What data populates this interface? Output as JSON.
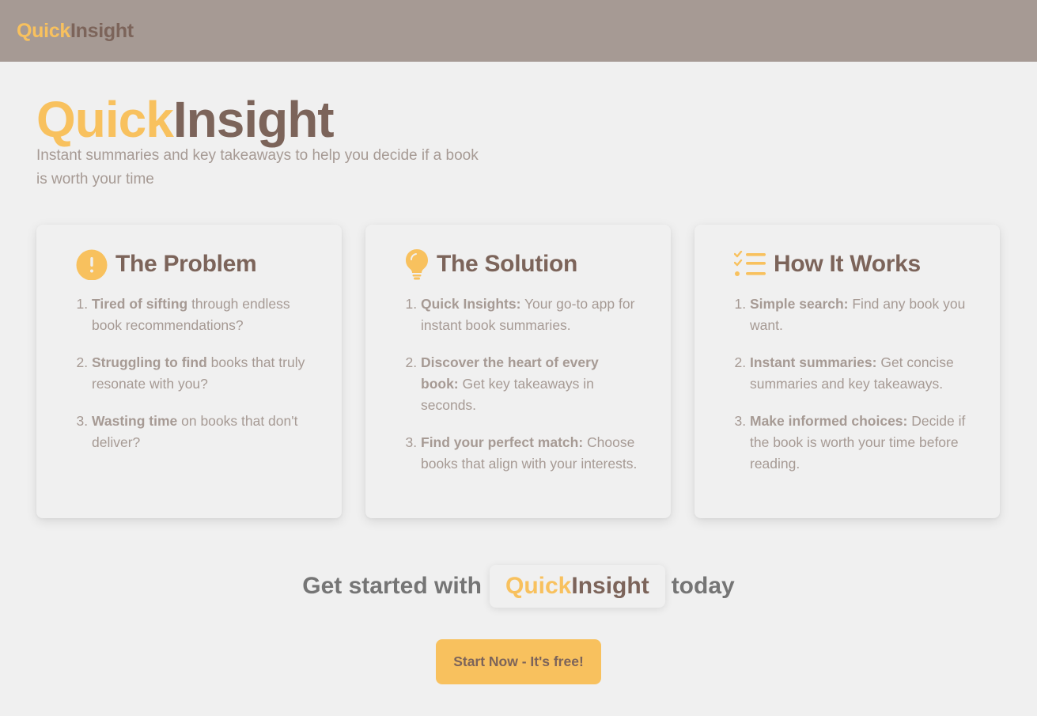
{
  "topbar": {
    "logo_part1": "Quick",
    "logo_part2": "Insight"
  },
  "hero": {
    "title_part1": "Quick",
    "title_part2": "Insight",
    "subtitle": "Instant summaries and key takeaways to help you decide if a book is worth your time"
  },
  "cards": [
    {
      "icon": "exclamation-circle-icon",
      "title": "The Problem",
      "items": [
        {
          "bold": "Tired of sifting",
          "text": " through endless book recommendations?"
        },
        {
          "bold": "Struggling to find",
          "text": " books that truly resonate with you?"
        },
        {
          "bold": "Wasting time",
          "text": " on books that don't deliver?"
        }
      ]
    },
    {
      "icon": "lightbulb-icon",
      "title": "The Solution",
      "items": [
        {
          "bold": "Quick Insights:",
          "text": " Your go-to app for instant book summaries."
        },
        {
          "bold": "Discover the heart of every book:",
          "text": " Get key takeaways in seconds."
        },
        {
          "bold": "Find your perfect match:",
          "text": " Choose books that align with your interests."
        }
      ]
    },
    {
      "icon": "checklist-icon",
      "title": "How It Works",
      "items": [
        {
          "bold": "Simple search:",
          "text": " Find any book you want."
        },
        {
          "bold": "Instant summaries:",
          "text": " Get concise summaries and key takeaways."
        },
        {
          "bold": "Make informed choices:",
          "text": " Decide if the book is worth your time before reading."
        }
      ]
    }
  ],
  "cta": {
    "prefix": "Get started with",
    "brand_part1": "Quick",
    "brand_part2": "Insight",
    "suffix": "today",
    "button_label": "Start Now - It's free!"
  },
  "colors": {
    "accent": "#f8c15e",
    "brown": "#7c645a",
    "muted": "#a69a94",
    "background": "#f0f0f0"
  }
}
